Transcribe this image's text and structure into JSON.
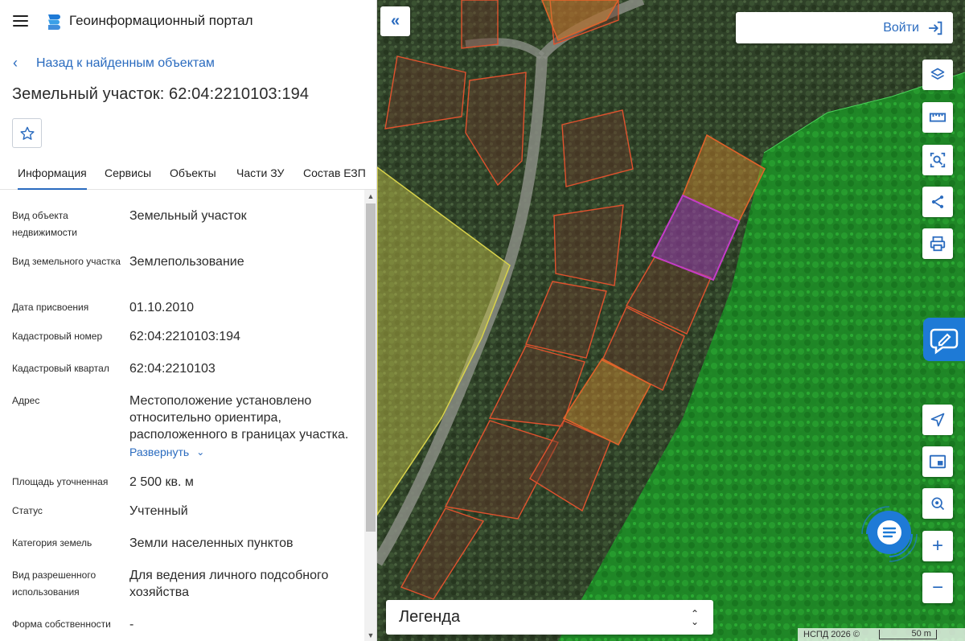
{
  "header": {
    "app_title": "Геоинформационный портал",
    "menu_icon": "menu-icon",
    "logo_icon": "portal-logo-icon"
  },
  "nav": {
    "back_label": "Назад к найденным объектам"
  },
  "object": {
    "title": "Земельный участок: 62:04:2210103:194"
  },
  "tabs": [
    {
      "label": "Информация",
      "active": true
    },
    {
      "label": "Сервисы",
      "active": false
    },
    {
      "label": "Объекты",
      "active": false
    },
    {
      "label": "Части ЗУ",
      "active": false
    },
    {
      "label": "Состав ЕЗП",
      "active": false
    }
  ],
  "properties": [
    {
      "label": "Вид объекта недвижимости",
      "value": "Земельный участок"
    },
    {
      "label": "Вид земельного участка",
      "value": "Землепользование"
    },
    {
      "label": "Дата присвоения",
      "value": "01.10.2010"
    },
    {
      "label": "Кадастровый номер",
      "value": "62:04:2210103:194"
    },
    {
      "label": "Кадастровый квартал",
      "value": "62:04:2210103"
    },
    {
      "label": "Адрес",
      "value": "Местоположение установлено относительно ориентира, расположенного в границах участка."
    },
    {
      "label": "Площадь уточненная",
      "value": "2 500 кв. м"
    },
    {
      "label": "Статус",
      "value": "Учтенный"
    },
    {
      "label": "Категория земель",
      "value": "Земли населенных пунктов"
    },
    {
      "label": "Вид разрешенного использования",
      "value": "Для ведения личного подсобного хозяйства"
    },
    {
      "label": "Форма собственности",
      "value": "-"
    }
  ],
  "expand_label": "Развернуть",
  "map": {
    "login_label": "Войти",
    "legend_label": "Легенда",
    "attribution": "НСПД 2026 ©",
    "scale_label": "50 m",
    "colors": {
      "accent": "#2a6bbf",
      "parcel_border": "#e0522e",
      "selected_border": "#c43cc8",
      "forest_zone": "#1f9a2a",
      "yellow_zone": "#d8d24a"
    }
  }
}
